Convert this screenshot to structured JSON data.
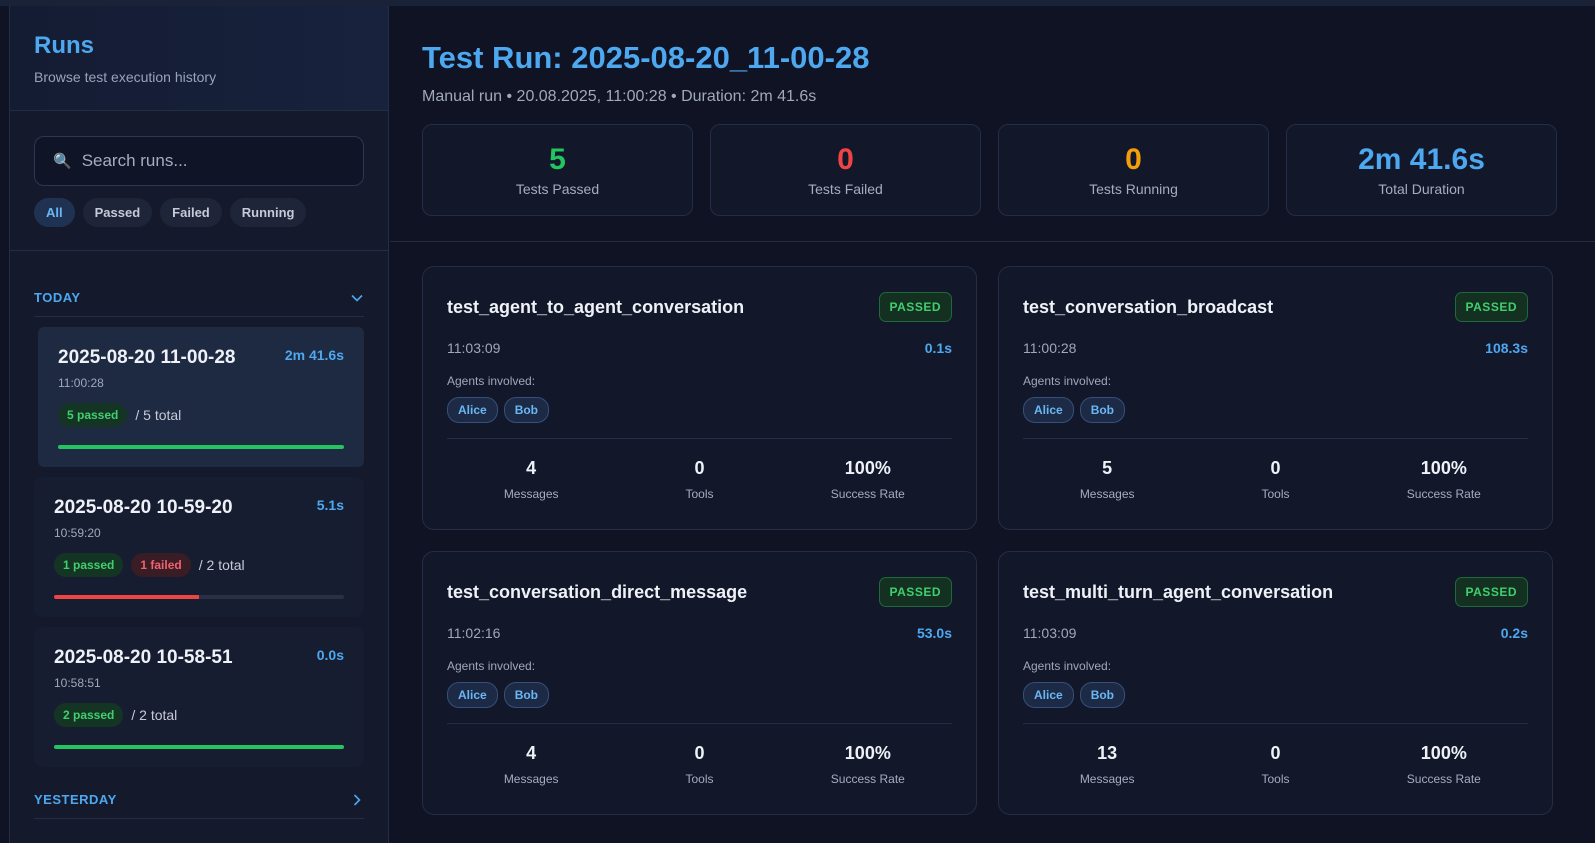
{
  "sidebar": {
    "title": "Runs",
    "subtitle": "Browse test execution history",
    "search_placeholder": "Search runs...",
    "filters": [
      "All",
      "Passed",
      "Failed",
      "Running"
    ],
    "active_filter": "All",
    "groups": [
      {
        "label": "TODAY",
        "expanded": true,
        "runs": [
          {
            "name": "2025-08-20 11-00-28",
            "time": "11:00:28",
            "duration": "2m 41.6s",
            "passed": "5 passed",
            "failed": "",
            "total": "/ 5 total",
            "pass_fraction": 1.0,
            "fail_fraction": 0.0,
            "selected": true
          },
          {
            "name": "2025-08-20 10-59-20",
            "time": "10:59:20",
            "duration": "5.1s",
            "passed": "1 passed",
            "failed": "1 failed",
            "total": "/ 2 total",
            "pass_fraction": 0.0,
            "fail_fraction": 0.5,
            "selected": false
          },
          {
            "name": "2025-08-20 10-58-51",
            "time": "10:58:51",
            "duration": "0.0s",
            "passed": "2 passed",
            "failed": "",
            "total": "/ 2 total",
            "pass_fraction": 1.0,
            "fail_fraction": 0.0,
            "selected": false
          }
        ]
      },
      {
        "label": "YESTERDAY",
        "expanded": false,
        "runs": []
      }
    ]
  },
  "main": {
    "title": "Test Run: 2025-08-20_11-00-28",
    "meta": "Manual run • 20.08.2025, 11:00:28 • Duration: 2m 41.6s",
    "stats": [
      {
        "value": "5",
        "label": "Tests Passed",
        "color": "#22c55e"
      },
      {
        "value": "0",
        "label": "Tests Failed",
        "color": "#ef4444"
      },
      {
        "value": "0",
        "label": "Tests Running",
        "color": "#f59e0b"
      },
      {
        "value": "2m 41.6s",
        "label": "Total Duration",
        "color": "#4da8f0"
      }
    ],
    "tests": [
      {
        "name": "test_agent_to_agent_conversation",
        "status": "PASSED",
        "time": "11:03:09",
        "duration": "0.1s",
        "agents_label": "Agents involved:",
        "agents": [
          "Alice",
          "Bob"
        ],
        "messages": "4",
        "tools": "0",
        "success": "100%"
      },
      {
        "name": "test_conversation_broadcast",
        "status": "PASSED",
        "time": "11:00:28",
        "duration": "108.3s",
        "agents_label": "Agents involved:",
        "agents": [
          "Alice",
          "Bob"
        ],
        "messages": "5",
        "tools": "0",
        "success": "100%"
      },
      {
        "name": "test_conversation_direct_message",
        "status": "PASSED",
        "time": "11:02:16",
        "duration": "53.0s",
        "agents_label": "Agents involved:",
        "agents": [
          "Alice",
          "Bob"
        ],
        "messages": "4",
        "tools": "0",
        "success": "100%"
      },
      {
        "name": "test_multi_turn_agent_conversation",
        "status": "PASSED",
        "time": "11:03:09",
        "duration": "0.2s",
        "agents_label": "Agents involved:",
        "agents": [
          "Alice",
          "Bob"
        ],
        "messages": "13",
        "tools": "0",
        "success": "100%"
      }
    ],
    "metric_labels": {
      "messages": "Messages",
      "tools": "Tools",
      "success": "Success Rate"
    }
  }
}
